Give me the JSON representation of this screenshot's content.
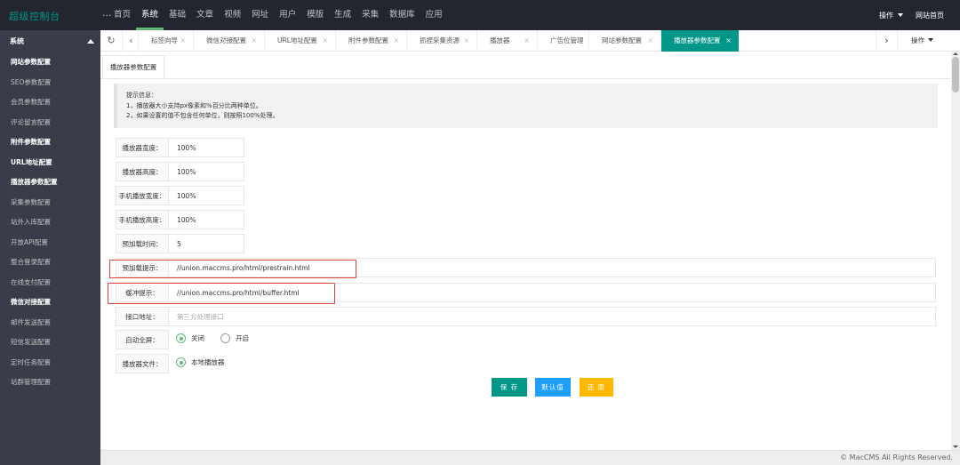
{
  "app": {
    "title": "超级控制台"
  },
  "topnav": {
    "items": [
      "首页",
      "系统",
      "基础",
      "文章",
      "视频",
      "网址",
      "用户",
      "模版",
      "生成",
      "采集",
      "数据库",
      "应用"
    ],
    "active": "系统",
    "more": "..."
  },
  "topright": {
    "ops": "操作",
    "home": "网站首页"
  },
  "sidebar": {
    "section": "系统",
    "items": [
      {
        "label": "网站参数配置",
        "bold": true
      },
      {
        "label": "SEO参数配置",
        "bold": false
      },
      {
        "label": "会员参数配置",
        "bold": false
      },
      {
        "label": "评论留言配置",
        "bold": false
      },
      {
        "label": "附件参数配置",
        "bold": true
      },
      {
        "label": "URL地址配置",
        "bold": true
      },
      {
        "label": "播放器参数配置",
        "bold": true
      },
      {
        "label": "采集参数配置",
        "bold": false
      },
      {
        "label": "站外入库配置",
        "bold": false
      },
      {
        "label": "开放API配置",
        "bold": false
      },
      {
        "label": "整合登录配置",
        "bold": false
      },
      {
        "label": "在线支付配置",
        "bold": false
      },
      {
        "label": "微信对接配置",
        "bold": true
      },
      {
        "label": "邮件发送配置",
        "bold": false
      },
      {
        "label": "短信发送配置",
        "bold": false
      },
      {
        "label": "定时任务配置",
        "bold": false
      },
      {
        "label": "站群管理配置",
        "bold": false
      }
    ]
  },
  "tabs": {
    "refresh_icon": "refresh-icon",
    "items": [
      {
        "label": "标签向导",
        "close": "×"
      },
      {
        "label": "微信对接配置",
        "close": "×"
      },
      {
        "label": "URL地址配置",
        "close": "×"
      },
      {
        "label": "附件参数配置",
        "close": "×"
      },
      {
        "label": "抓捏采集资源",
        "close": "×"
      },
      {
        "label": "播放器",
        "close": "×"
      },
      {
        "label": "广告位管理",
        "close": "×"
      },
      {
        "label": "网站参数配置",
        "close": "×"
      },
      {
        "label": "播放器参数配置",
        "close": "×"
      }
    ],
    "active": "播放器参数配置",
    "ops": "操作"
  },
  "content": {
    "tab_title": "播放器参数配置",
    "tip": {
      "title": "提示信息：",
      "line1": "1，播放器大小支持px像素和%百分比两种单位。",
      "line2": "2，如果设置的值不包含任何单位，则按照100%处理。"
    },
    "fields": {
      "width": {
        "label": "播放器宽度：",
        "value": "100%"
      },
      "height": {
        "label": "播放器高度：",
        "value": "100%"
      },
      "m_width": {
        "label": "手机播放宽度：",
        "value": "100%"
      },
      "m_height": {
        "label": "手机播放高度：",
        "value": "100%"
      },
      "preload_time": {
        "label": "预加载时间：",
        "value": "5"
      },
      "preload_tip": {
        "label": "预加载提示：",
        "value": "//union.maccms.pro/html/prestrain.html"
      },
      "buffer_tip": {
        "label": "缓冲提示：",
        "value": "//union.maccms.pro/html/buffer.html"
      },
      "api": {
        "label": "接口地址：",
        "placeholder": "第三方处理接口"
      },
      "autofull": {
        "label": "自动全屏：",
        "off": "关闭",
        "on": "开启",
        "selected": "关闭"
      },
      "player_file": {
        "label": "播放器文件：",
        "option": "本地播放器",
        "selected": "本地播放器"
      }
    },
    "buttons": {
      "save": "保 存",
      "default": "默认值",
      "reset": "还 原"
    },
    "colors": {
      "save": "#009688",
      "default": "#1e9fff",
      "reset": "#ffb800",
      "highlight": "#e0403c"
    }
  },
  "footer": {
    "copyright": "© MacCMS All Rights Reserved."
  }
}
